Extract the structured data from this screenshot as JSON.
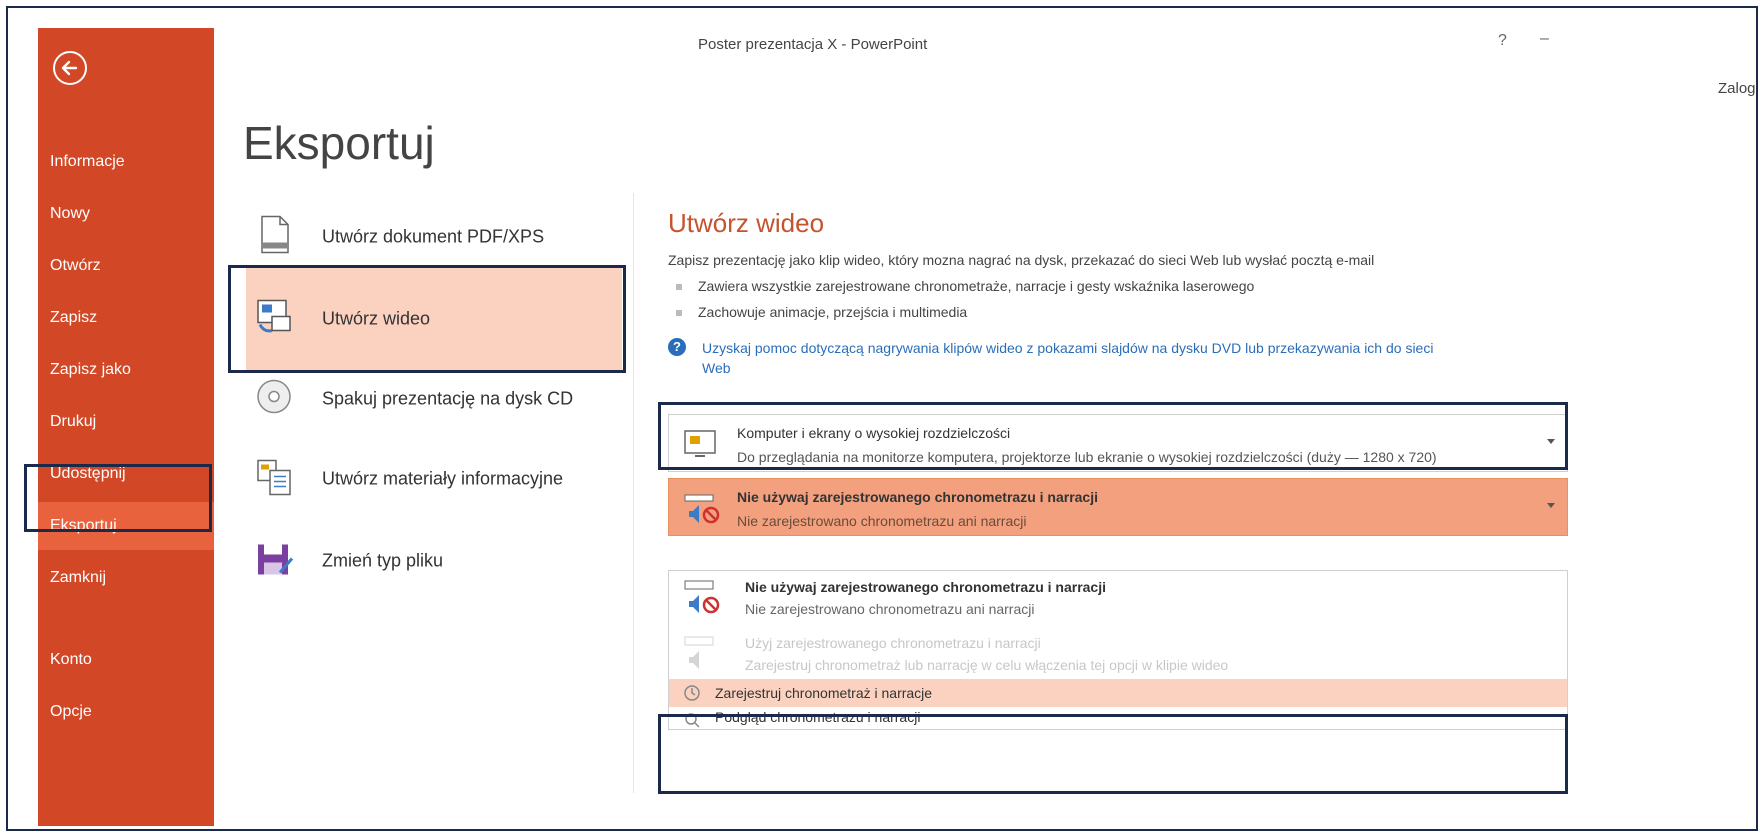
{
  "window": {
    "title": "Poster prezentacja X - PowerPoint",
    "help": "?",
    "minimize": "–",
    "login": "Zalogu"
  },
  "sidebar": {
    "items": [
      {
        "label": "Informacje"
      },
      {
        "label": "Nowy"
      },
      {
        "label": "Otwórz"
      },
      {
        "label": "Zapisz"
      },
      {
        "label": "Zapisz jako"
      },
      {
        "label": "Drukuj"
      },
      {
        "label": "Udostępnij"
      },
      {
        "label": "Eksportuj"
      },
      {
        "label": "Zamknij"
      },
      {
        "label": "Konto"
      },
      {
        "label": "Opcje"
      }
    ],
    "active": "Eksportuj",
    "color": "#d24726"
  },
  "page": {
    "title": "Eksportuj"
  },
  "export_options": [
    {
      "label": "Utwórz dokument PDF/XPS",
      "icon": "pdf-document-icon"
    },
    {
      "label": "Utwórz wideo",
      "icon": "create-video-icon"
    },
    {
      "label": "Spakuj prezentację na dysk CD",
      "icon": "cd-disc-icon"
    },
    {
      "label": "Utwórz materiały informacyjne",
      "icon": "handouts-icon"
    },
    {
      "label": "Zmień typ pliku",
      "icon": "change-file-type-icon"
    }
  ],
  "video_panel": {
    "title": "Utwórz wideo",
    "description": "Zapisz prezentację jako klip wideo, który mozna nagrać na dysk, przekazać do sieci Web lub wysłać pocztą e-mail",
    "bullets": [
      "Zawiera wszystkie zarejestrowane chronometraże, narracje i gesty wskaźnika laserowego",
      "Zachowuje animacje, przejścia i multimedia"
    ],
    "help_link_line1": "Uzyskaj pomoc dotyczącą nagrywania klipów wideo z pokazami slajdów na dysku DVD lub przekazywania ich do sieci",
    "help_link_line2": "Web",
    "quality_dropdown": {
      "title": "Komputer i ekrany o wysokiej rozdzielczości",
      "subtitle": "Do przeglądania na monitorze komputera, projektorze lub ekranie o wysokiej rozdzielczości (duży — 1280 x 720)"
    },
    "timing_dropdown": {
      "title": "Nie używaj zarejestrowanego chronometrazu i narracji",
      "subtitle": "Nie zarejestrowano chronometrazu ani narracji"
    },
    "timing_menu": {
      "items": [
        {
          "title": "Nie używaj zarejestrowanego chronometrazu i narracji",
          "subtitle": "Nie zarejestrowano chronometrazu ani narracji"
        },
        {
          "title": "Użyj zarejestrowanego chronometrazu i narracji",
          "subtitle": "Zarejestruj chronometraż lub narrację w celu włączenia tej opcji w klipie wideo"
        }
      ],
      "record_label": "Zarejestruj chronometraż i narracje",
      "preview_label": "Podgląd chronometrazu i narracji"
    }
  }
}
